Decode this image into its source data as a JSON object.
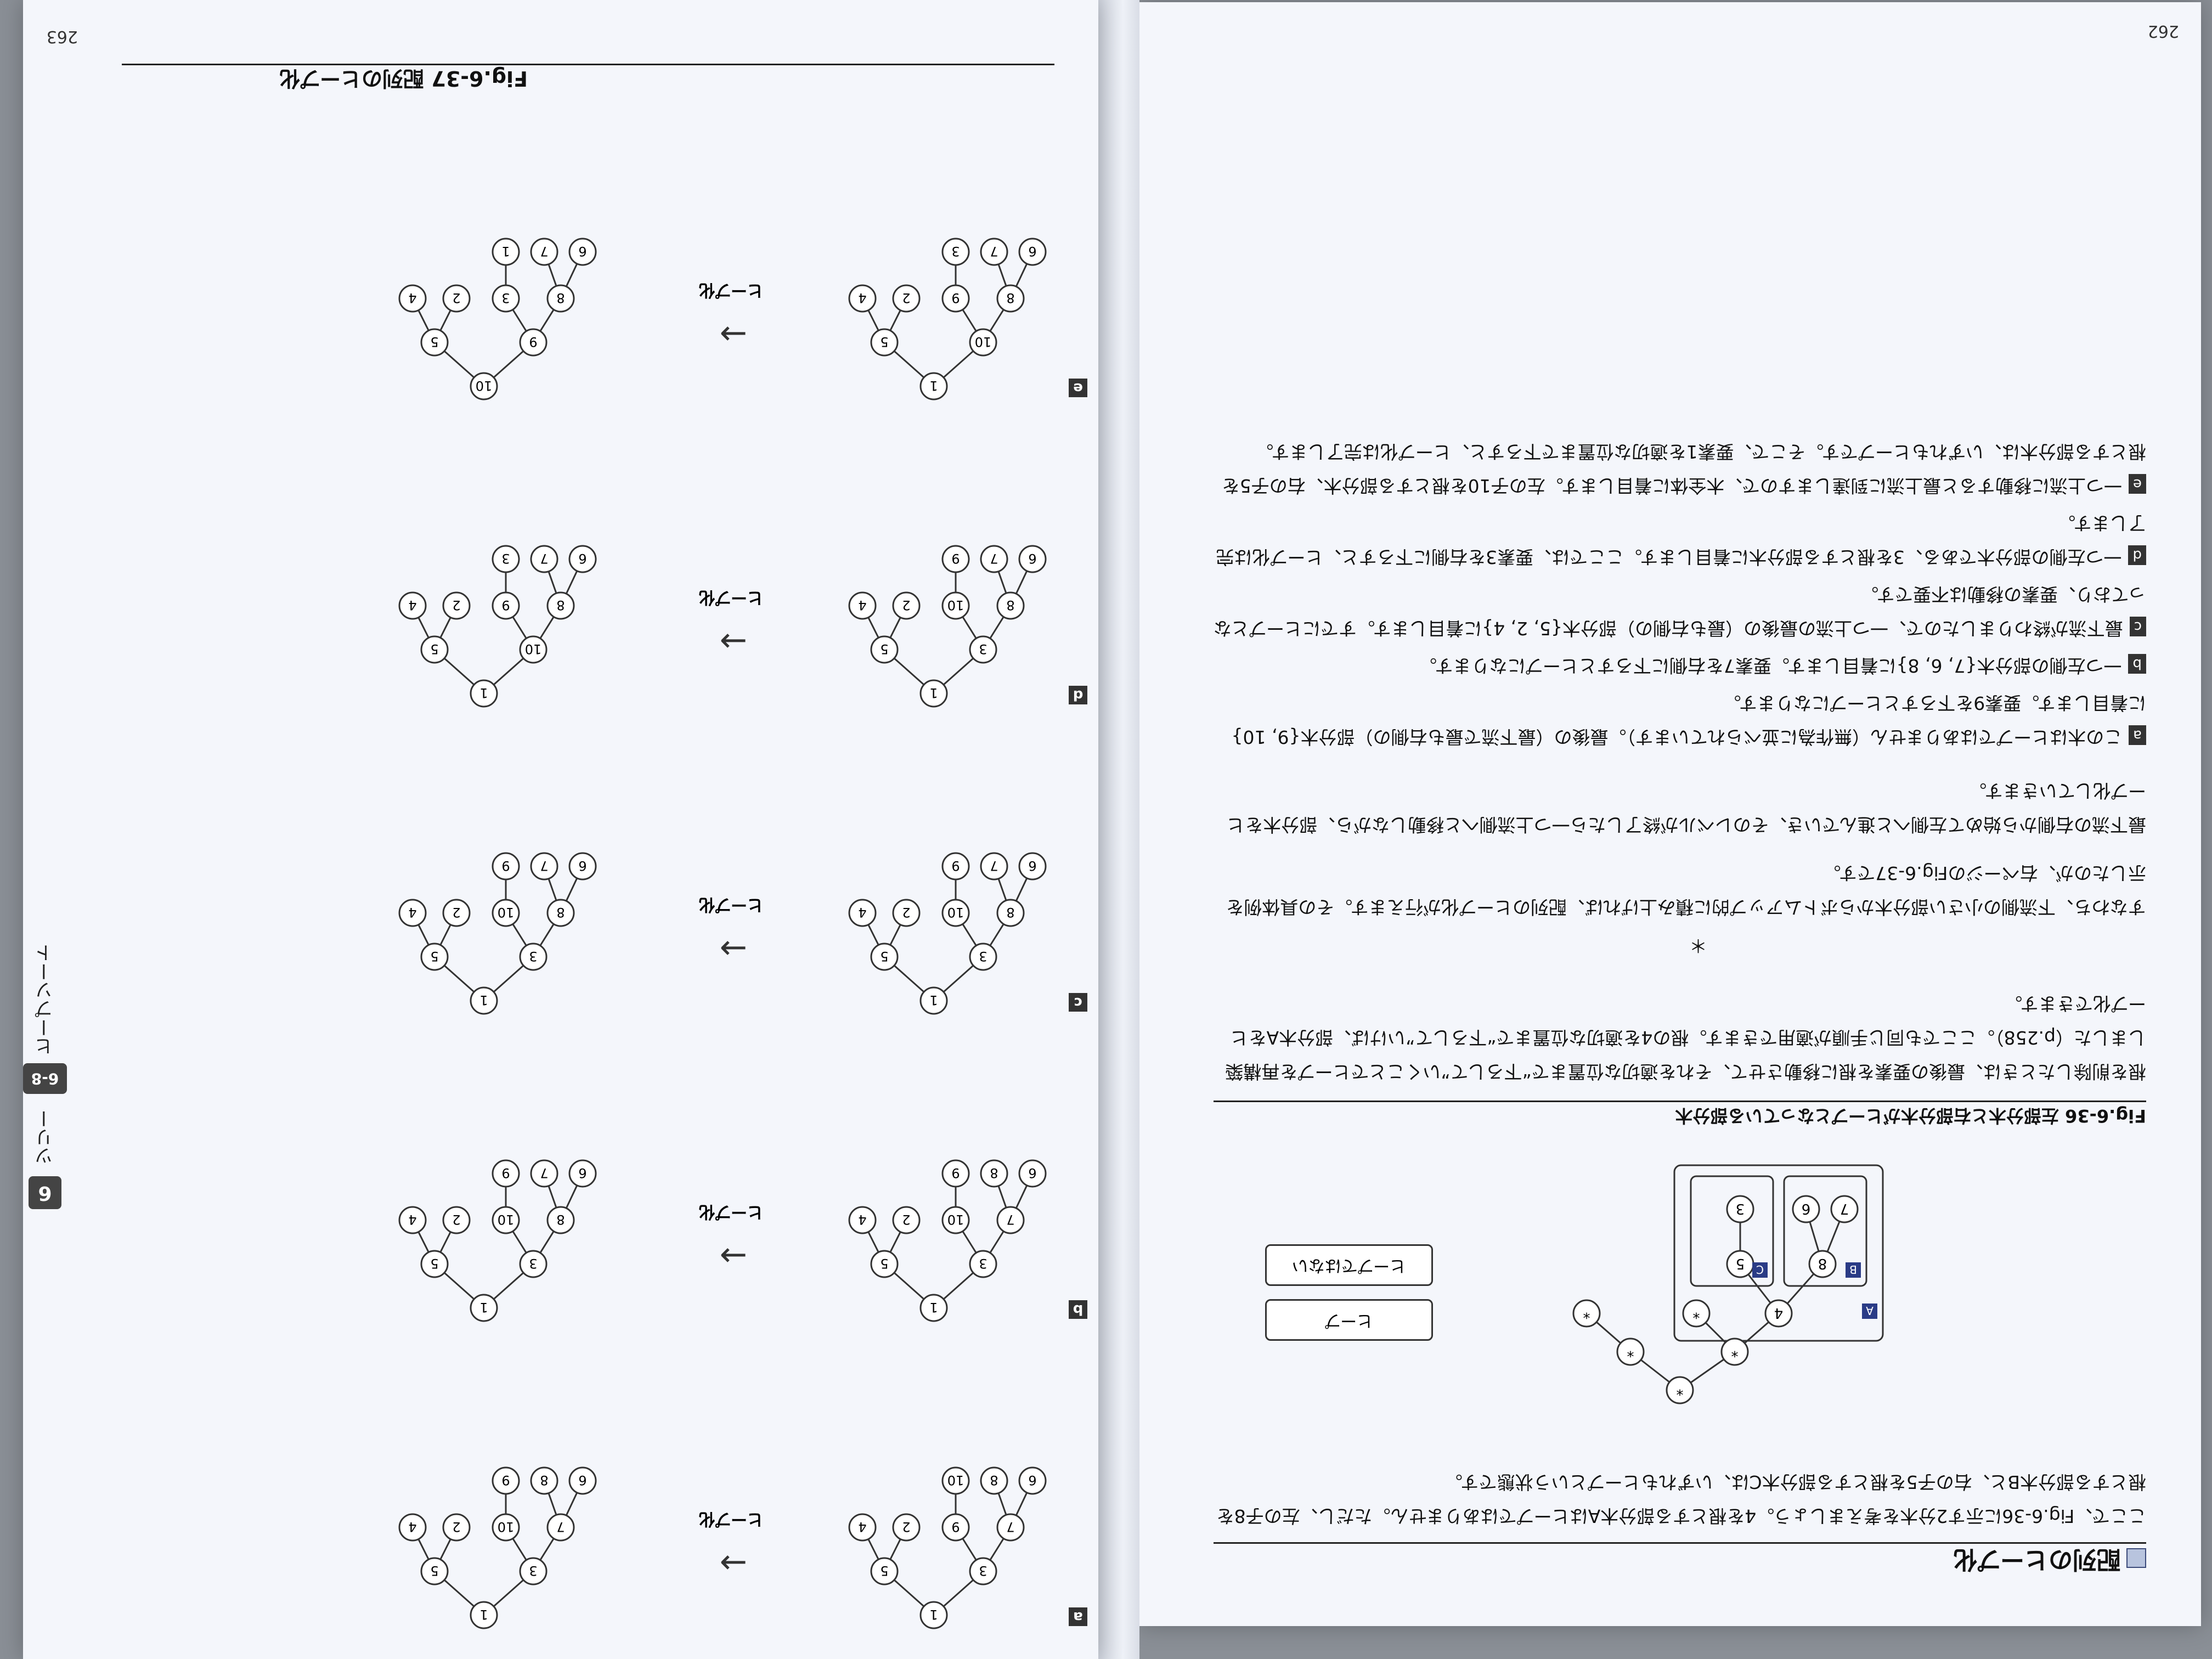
{
  "book": {
    "page_left_number": "262",
    "page_right_number": "263",
    "chapter_tab": "6",
    "chapter_side_text": "ツリー",
    "section_tab": "6-8",
    "section_side_text": "ヒープソート"
  },
  "left_page": {
    "heading": "配列のヒープ化",
    "intro": "ここで、Fig.6-36に示す2分木を考えましょう。4を根とする部分木Aはヒープではありません。ただし、左の子8を根とする部分木Bと、右の子5を根とする部分木Cは、いずれもヒープという状態です。",
    "fig36_caption": "Fig.6-36 左部分木と右部分木がヒープとなっている部分木",
    "fig36_heap": "ヒープ",
    "fig36_not_heap": "ヒープではない",
    "fig36_labels": {
      "A": "A",
      "B": "B",
      "C": "C"
    },
    "fig36_nodes": {
      "root": "*",
      "n1": "*",
      "n2": "*",
      "n3": "*",
      "n4": "*",
      "a": "4",
      "b": "8",
      "c": "5",
      "d": "7",
      "e": "6",
      "f": "3"
    },
    "para1": "根を削除したときは、最後の要素を根に移動させて、それを適切な位置まで“下ろして”いくことでヒープを再構築しました（p.258）。ここでも同じ手順が適用できます。根の4を適切な位置まで“下ろして”いけば、部分木Aをヒープ化できます。",
    "asterisk": "＊",
    "para2": "すなわち、下流側の小さい部分木からボトムアップ的に積み上げれば、配列のヒープ化が行えます。その具体例を示したのが、右ページのFig.6-37です。",
    "para3": "最下流の右側から始めて左側へと進んでいき、そのレベルが終了したら一つ上流側へと移動しながら、部分木をヒープ化していきます。",
    "steps": [
      {
        "tag": "a",
        "text": "この木はヒープではありません（無作為に並べられています）。最後の（最下流で最も右側の）部分木{9, 10}に着目します。要素9を下ろすとヒープになります。"
      },
      {
        "tag": "b",
        "text": "一つ左側の部分木{7, 6, 8}に着目します。要素7を右側に下ろすとヒープになります。"
      },
      {
        "tag": "c",
        "text": "最下流が終わりましたので、一つ上流の最後の（最も右側の）部分木{5, 2, 4}に着目します。すでにヒープとなっており、要素の移動は不要です。"
      },
      {
        "tag": "d",
        "text": "一つ左側の部分木である、3を根とする部分木に着目します。ここでは、要素3を右側に下ろすと、ヒープ化は完了します。"
      },
      {
        "tag": "e",
        "text": "一つ上流に移動すると最上流に到達しますので、木全体に着目します。左の子10を根とする部分木、右の子5を根とする部分木は、いずれもヒープです。そこで、要素1を適切な位置まで下ろすと、ヒープ化は完了します。"
      }
    ]
  },
  "right_page": {
    "figure_caption": "Fig.6-37 配列のヒープ化",
    "arrow_label": "ヒープ化",
    "steps": [
      {
        "tag": "a",
        "before": [
          "1",
          "3",
          "5",
          "7",
          "9",
          "2",
          "4",
          "6",
          "8",
          "10"
        ],
        "after": [
          "1",
          "3",
          "5",
          "7",
          "10",
          "2",
          "4",
          "6",
          "8",
          "9"
        ]
      },
      {
        "tag": "b",
        "before": [
          "1",
          "3",
          "5",
          "7",
          "10",
          "2",
          "4",
          "6",
          "8",
          "9"
        ],
        "after": [
          "1",
          "3",
          "5",
          "8",
          "10",
          "2",
          "4",
          "6",
          "7",
          "9"
        ]
      },
      {
        "tag": "c",
        "before": [
          "1",
          "3",
          "5",
          "8",
          "10",
          "2",
          "4",
          "6",
          "7",
          "9"
        ],
        "after": [
          "1",
          "3",
          "5",
          "8",
          "10",
          "2",
          "4",
          "6",
          "7",
          "9"
        ]
      },
      {
        "tag": "d",
        "before": [
          "1",
          "3",
          "5",
          "8",
          "10",
          "2",
          "4",
          "6",
          "7",
          "9"
        ],
        "after": [
          "1",
          "10",
          "5",
          "8",
          "9",
          "2",
          "4",
          "6",
          "7",
          "3"
        ]
      },
      {
        "tag": "e",
        "before": [
          "1",
          "10",
          "5",
          "8",
          "9",
          "2",
          "4",
          "6",
          "7",
          "3"
        ],
        "after": [
          "10",
          "9",
          "5",
          "8",
          "3",
          "2",
          "4",
          "6",
          "7",
          "1"
        ]
      }
    ]
  }
}
